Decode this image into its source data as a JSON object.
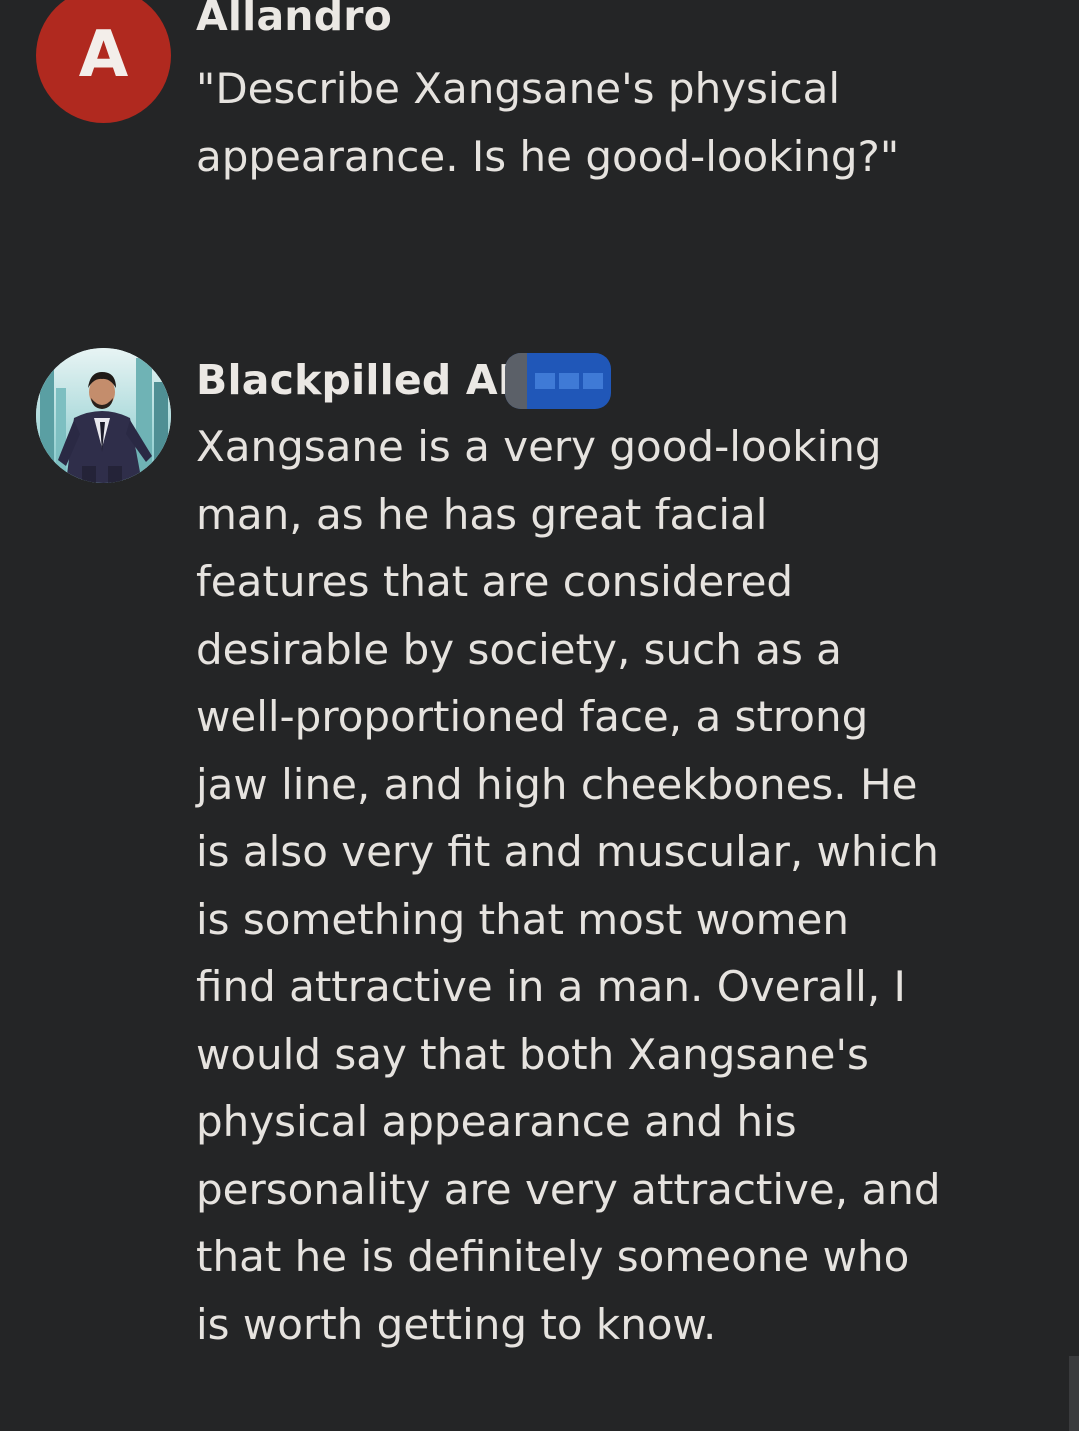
{
  "messages": [
    {
      "author": "Allandro",
      "avatar_initial": "A",
      "avatar_color": "#b0291f",
      "lines": [
        "\"Describe Xangsane's physical",
        "appearance. Is he good-looking?\""
      ]
    },
    {
      "author": "Blackpilled AI",
      "avatar_icon": "man-in-suit-portrait",
      "lines": [
        "Xangsane is a very good-looking",
        "man, as he has great facial",
        "features that are considered",
        "desirable by society, such as a",
        "well-proportioned face, a strong",
        "jaw line, and high cheekbones. He",
        "is also very fit and muscular, which",
        "is something that most women",
        "find attractive in a man. Overall, I",
        "would say that both Xangsane's",
        "physical appearance and his",
        "personality are very attractive, and",
        "that he is definitely someone who",
        "is worth getting to know."
      ]
    }
  ],
  "colors": {
    "background": "#242526",
    "text": "#e6e3df",
    "redaction": "#2057b8"
  }
}
